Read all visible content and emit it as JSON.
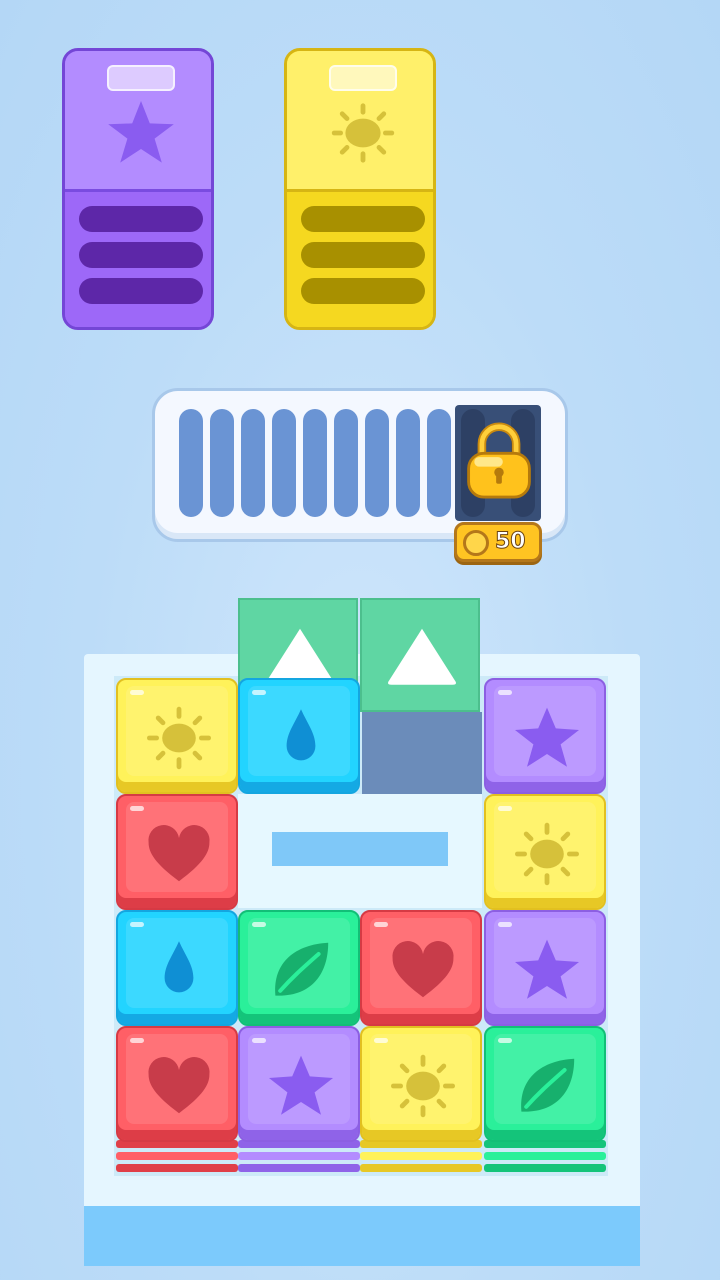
{
  "colors": {
    "background": "#bcdcf8",
    "yellow": "#fff25a",
    "purple": "#b38cff",
    "red": "#ff5f66",
    "cyan": "#22d4ff",
    "green": "#2af09a",
    "queue_slot": "#6a94d4",
    "locked_slot": "#384f77",
    "coin_badge": "#ffc422"
  },
  "collectors": [
    {
      "color": "purple",
      "icon": "star-icon",
      "slots_filled": 0,
      "slots_total": 3
    },
    {
      "color": "yellow",
      "icon": "sun-icon",
      "slots_filled": 0,
      "slots_total": 3
    }
  ],
  "queue": {
    "open_slots": 9,
    "locked_slots": 2,
    "unlock_price": "50",
    "lock_icon": "padlock-icon",
    "coin_icon": "coin-icon"
  },
  "board": {
    "rows": 4,
    "cols": 4,
    "entrance_arrows": 2,
    "arrow_icon": "up-arrow-icon",
    "tiles": [
      {
        "row": 1,
        "col": 1,
        "color": "yellow",
        "icon": "sun-icon",
        "stack": 0
      },
      {
        "row": 1,
        "col": 2,
        "color": "cyan",
        "icon": "drop-icon",
        "stack": 0
      },
      {
        "row": 1,
        "col": 4,
        "color": "purple",
        "icon": "star-icon",
        "stack": 0
      },
      {
        "row": 2,
        "col": 1,
        "color": "red",
        "icon": "heart-icon",
        "stack": 0
      },
      {
        "row": 2,
        "col": 4,
        "color": "yellow",
        "icon": "sun-icon",
        "stack": 0
      },
      {
        "row": 3,
        "col": 1,
        "color": "cyan",
        "icon": "drop-icon",
        "stack": 0
      },
      {
        "row": 3,
        "col": 2,
        "color": "green",
        "icon": "leaf-icon",
        "stack": 0
      },
      {
        "row": 3,
        "col": 3,
        "color": "red",
        "icon": "heart-icon",
        "stack": 0
      },
      {
        "row": 3,
        "col": 4,
        "color": "purple",
        "icon": "star-icon",
        "stack": 0
      },
      {
        "row": 4,
        "col": 1,
        "color": "red",
        "icon": "heart-icon",
        "stack": 3
      },
      {
        "row": 4,
        "col": 2,
        "color": "purple",
        "icon": "star-icon",
        "stack": 3
      },
      {
        "row": 4,
        "col": 3,
        "color": "yellow",
        "icon": "sun-icon",
        "stack": 3
      },
      {
        "row": 4,
        "col": 4,
        "color": "green",
        "icon": "leaf-icon",
        "stack": 3
      }
    ]
  }
}
